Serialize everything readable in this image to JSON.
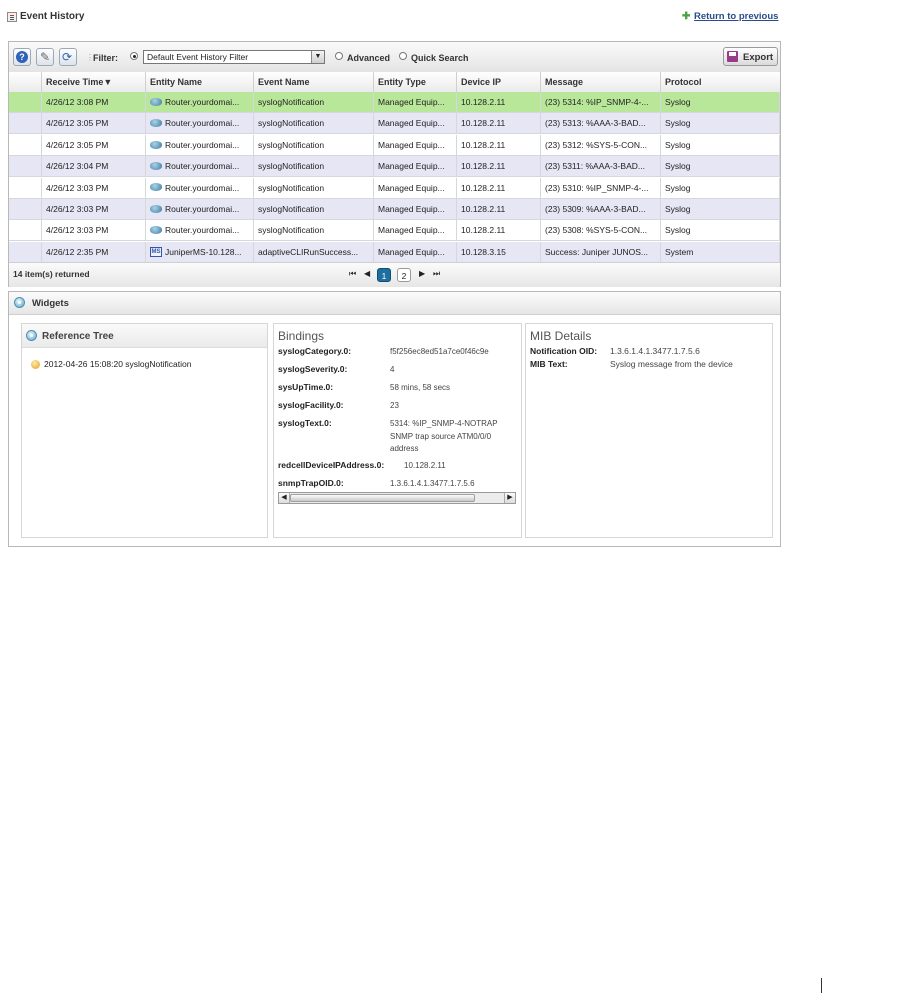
{
  "header": {
    "title": "Event History",
    "return_link": "Return to previous"
  },
  "toolbar": {
    "filter_label": "Filter:",
    "filter_value": "Default Event History Filter",
    "advanced_label": "Advanced",
    "quick_search_label": "Quick Search",
    "export_label": "Export",
    "filter_mode_selected": "filter"
  },
  "table": {
    "columns": [
      "Receive Time",
      "Entity Name",
      "Event Name",
      "Entity Type",
      "Device IP",
      "Message",
      "Protocol"
    ],
    "sort_column": "Receive Time",
    "sort_direction": "descending",
    "rows": [
      {
        "time": "4/26/12 3:08 PM",
        "entity_icon": "router-icon",
        "entity": "Router.yourdomai...",
        "event": "syslogNotification",
        "type": "Managed Equip...",
        "ip": "10.128.2.11",
        "message": "(23) 5314: %IP_SNMP-4-...",
        "protocol": "Syslog",
        "selected": true
      },
      {
        "time": "4/26/12 3:05 PM",
        "entity_icon": "router-icon",
        "entity": "Router.yourdomai...",
        "event": "syslogNotification",
        "type": "Managed Equip...",
        "ip": "10.128.2.11",
        "message": "(23) 5313: %AAA-3-BAD...",
        "protocol": "Syslog"
      },
      {
        "time": "4/26/12 3:05 PM",
        "entity_icon": "router-icon",
        "entity": "Router.yourdomai...",
        "event": "syslogNotification",
        "type": "Managed Equip...",
        "ip": "10.128.2.11",
        "message": "(23) 5312: %SYS-5-CON...",
        "protocol": "Syslog"
      },
      {
        "time": "4/26/12 3:04 PM",
        "entity_icon": "router-icon",
        "entity": "Router.yourdomai...",
        "event": "syslogNotification",
        "type": "Managed Equip...",
        "ip": "10.128.2.11",
        "message": "(23) 5311: %AAA-3-BAD...",
        "protocol": "Syslog"
      },
      {
        "time": "4/26/12 3:03 PM",
        "entity_icon": "router-icon",
        "entity": "Router.yourdomai...",
        "event": "syslogNotification",
        "type": "Managed Equip...",
        "ip": "10.128.2.11",
        "message": "(23) 5310: %IP_SNMP-4-...",
        "protocol": "Syslog"
      },
      {
        "time": "4/26/12 3:03 PM",
        "entity_icon": "router-icon",
        "entity": "Router.yourdomai...",
        "event": "syslogNotification",
        "type": "Managed Equip...",
        "ip": "10.128.2.11",
        "message": "(23) 5309: %AAA-3-BAD...",
        "protocol": "Syslog"
      },
      {
        "time": "4/26/12 3:03 PM",
        "entity_icon": "router-icon",
        "entity": "Router.yourdomai...",
        "event": "syslogNotification",
        "type": "Managed Equip...",
        "ip": "10.128.2.11",
        "message": "(23) 5308: %SYS-5-CON...",
        "protocol": "Syslog"
      },
      {
        "time": "4/26/12 2:35 PM",
        "entity_icon": "ms-icon",
        "entity": "JuniperMS-10.128...",
        "event": "adaptiveCLIRunSuccess...",
        "type": "Managed Equip...",
        "ip": "10.128.3.15",
        "message": "Success: Juniper JUNOS...",
        "protocol": "System"
      }
    ],
    "item_count": "14 item(s) returned",
    "pages": [
      "1",
      "2"
    ],
    "current_page": "1"
  },
  "widgets": {
    "title": "Widgets",
    "reference_tree": {
      "title": "Reference Tree",
      "node": "2012-04-26 15:08:20 syslogNotification"
    },
    "bindings": {
      "title": "Bindings",
      "items": [
        {
          "key": "syslogCategory.0:",
          "value": "f5f256ec8ed51a7ce0f46c9e"
        },
        {
          "key": "syslogSeverity.0:",
          "value": "4"
        },
        {
          "key": "sysUpTime.0:",
          "value": "58 mins, 58 secs"
        },
        {
          "key": "syslogFacility.0:",
          "value": "23"
        },
        {
          "key": "syslogText.0:",
          "value_lines": [
            "5314: %IP_SNMP-4-NOTRAP",
            "SNMP trap source ATM0/0/0",
            "address"
          ]
        },
        {
          "key": "redcellDeviceIPAddress.0:",
          "value": "10.128.2.11"
        },
        {
          "key": "snmpTrapOID.0:",
          "value": "1.3.6.1.4.1.3477.1.7.5.6"
        }
      ]
    },
    "mib_details": {
      "title": "MIB Details",
      "notification_oid_label": "Notification OID:",
      "notification_oid": "1.3.6.1.4.1.3477.1.7.5.6",
      "mib_text_label": "MIB Text:",
      "mib_text": "Syslog message from the device"
    }
  },
  "colors": {
    "selected_row": "#b9e79a",
    "alt_row": "#e6e6f5",
    "link": "#2a4d8a",
    "active_page": "#1e6ea0"
  }
}
